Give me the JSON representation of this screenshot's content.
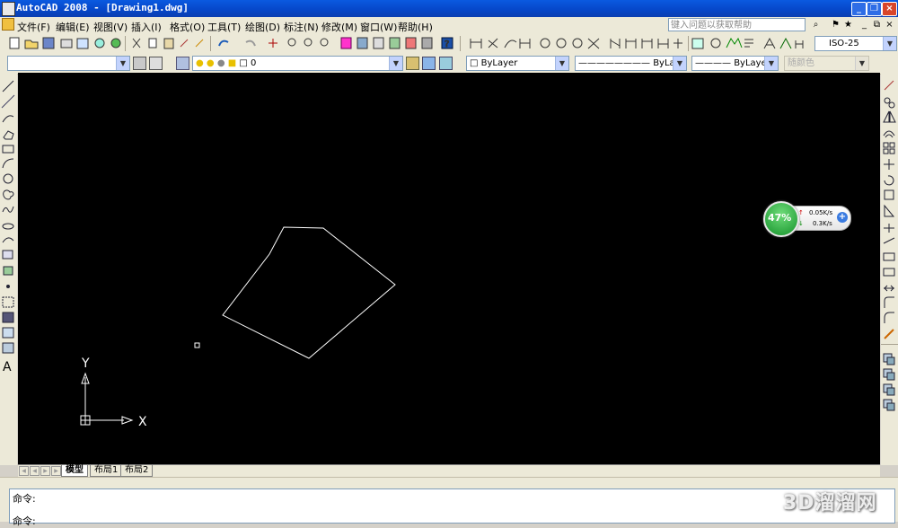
{
  "title_bar": {
    "title": "AutoCAD 2008 - [Drawing1.dwg]",
    "buttons": [
      "minimize",
      "restore",
      "close"
    ]
  },
  "menu_bar": {
    "items": [
      "文件(F)",
      "编辑(E)",
      "视图(V)",
      "插入(I)",
      "格式(O)",
      "工具(T)",
      "绘图(D)",
      "标注(N)",
      "修改(M)",
      "窗口(W)",
      "帮助(H)"
    ],
    "help_search": {
      "placeholder": "键入问题以获取帮助"
    },
    "doc_buttons": [
      "_",
      "⧉",
      "×"
    ]
  },
  "toolbar_standard": {
    "dimstyle_value": "ISO-25"
  },
  "toolbar_layers": {
    "workspace_value": "",
    "layer_value": "0",
    "color_value": "ByLayer",
    "linetype_value": "ByLayer",
    "lineweight_value": "ByLayer",
    "plotstyle_value": "随颜色"
  },
  "net_widget": {
    "percent": "47%",
    "up": "0.05K/s",
    "down": "0.3K/s"
  },
  "ucs": {
    "x_label": "X",
    "y_label": "Y"
  },
  "layout_tabs": [
    "模型",
    "布局1",
    "布局2"
  ],
  "active_tab": "模型",
  "command": {
    "line1": "命令:",
    "line2": "命令:"
  },
  "watermark": "3D溜溜网",
  "colors": {
    "titlebar": "#0a5ae0",
    "canvas": "#000000",
    "toolbar": "#ece9d8",
    "drawing_line": "#ffffff"
  }
}
